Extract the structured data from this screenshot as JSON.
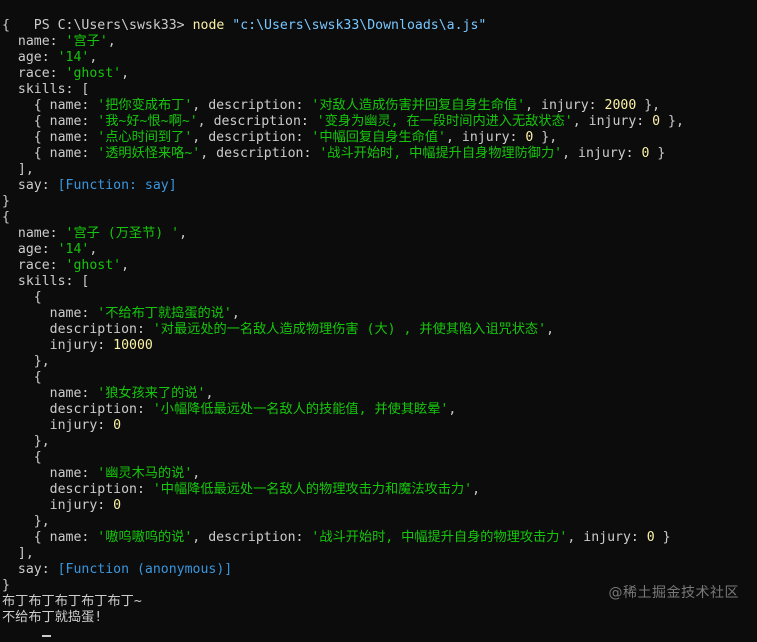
{
  "terminal": {
    "prompt": "PS C:\\Users\\swsk33> ",
    "command": "node",
    "argument": " \"c:\\Users\\swsk33\\Downloads\\a.js\""
  },
  "lines": [
    [
      [
        "p",
        "{"
      ]
    ],
    [
      [
        "k",
        "  name: "
      ],
      [
        "s",
        "'宫子'"
      ],
      [
        "p",
        ","
      ]
    ],
    [
      [
        "k",
        "  age: "
      ],
      [
        "s",
        "'14'"
      ],
      [
        "p",
        ","
      ]
    ],
    [
      [
        "k",
        "  race: "
      ],
      [
        "s",
        "'ghost'"
      ],
      [
        "p",
        ","
      ]
    ],
    [
      [
        "k",
        "  skills: ["
      ]
    ],
    [
      [
        "p",
        "    { "
      ],
      [
        "k",
        "name: "
      ],
      [
        "s",
        "'把你变成布丁'"
      ],
      [
        "p",
        ", "
      ],
      [
        "k",
        "description: "
      ],
      [
        "s",
        "'对敌人造成伤害并回复自身生命值'"
      ],
      [
        "p",
        ", "
      ],
      [
        "k",
        "injury: "
      ],
      [
        "n",
        "2000"
      ],
      [
        "p",
        " },"
      ]
    ],
    [
      [
        "p",
        "    { "
      ],
      [
        "k",
        "name: "
      ],
      [
        "s",
        "'我~好~恨~啊~'"
      ],
      [
        "p",
        ", "
      ],
      [
        "k",
        "description: "
      ],
      [
        "s",
        "'变身为幽灵, 在一段时间内进入无敌状态'"
      ],
      [
        "p",
        ", "
      ],
      [
        "k",
        "injury: "
      ],
      [
        "n",
        "0"
      ],
      [
        "p",
        " },"
      ]
    ],
    [
      [
        "p",
        "    { "
      ],
      [
        "k",
        "name: "
      ],
      [
        "s",
        "'点心时间到了'"
      ],
      [
        "p",
        ", "
      ],
      [
        "k",
        "description: "
      ],
      [
        "s",
        "'中幅回复自身生命值'"
      ],
      [
        "p",
        ", "
      ],
      [
        "k",
        "injury: "
      ],
      [
        "n",
        "0"
      ],
      [
        "p",
        " },"
      ]
    ],
    [
      [
        "p",
        "    { "
      ],
      [
        "k",
        "name: "
      ],
      [
        "s",
        "'透明妖怪来咯~'"
      ],
      [
        "p",
        ", "
      ],
      [
        "k",
        "description: "
      ],
      [
        "s",
        "'战斗开始时, 中幅提升自身物理防御力'"
      ],
      [
        "p",
        ", "
      ],
      [
        "k",
        "injury: "
      ],
      [
        "n",
        "0"
      ],
      [
        "p",
        " }"
      ]
    ],
    [
      [
        "p",
        "  ],"
      ]
    ],
    [
      [
        "k",
        "  say: "
      ],
      [
        "f",
        "[Function: say]"
      ]
    ],
    [
      [
        "p",
        "}"
      ]
    ],
    [
      [
        "p",
        "{"
      ]
    ],
    [
      [
        "k",
        "  name: "
      ],
      [
        "s",
        "'宫子 (万圣节) '"
      ],
      [
        "p",
        ","
      ]
    ],
    [
      [
        "k",
        "  age: "
      ],
      [
        "s",
        "'14'"
      ],
      [
        "p",
        ","
      ]
    ],
    [
      [
        "k",
        "  race: "
      ],
      [
        "s",
        "'ghost'"
      ],
      [
        "p",
        ","
      ]
    ],
    [
      [
        "k",
        "  skills: ["
      ]
    ],
    [
      [
        "p",
        "    {"
      ]
    ],
    [
      [
        "k",
        "      name: "
      ],
      [
        "s",
        "'不给布丁就捣蛋的说'"
      ],
      [
        "p",
        ","
      ]
    ],
    [
      [
        "k",
        "      description: "
      ],
      [
        "s",
        "'对最远处的一名敌人造成物理伤害 (大) , 并使其陷入诅咒状态'"
      ],
      [
        "p",
        ","
      ]
    ],
    [
      [
        "k",
        "      injury: "
      ],
      [
        "n",
        "10000"
      ]
    ],
    [
      [
        "p",
        "    },"
      ]
    ],
    [
      [
        "p",
        "    {"
      ]
    ],
    [
      [
        "k",
        "      name: "
      ],
      [
        "s",
        "'狼女孩来了的说'"
      ],
      [
        "p",
        ","
      ]
    ],
    [
      [
        "k",
        "      description: "
      ],
      [
        "s",
        "'小幅降低最远处一名敌人的技能值, 并使其眩晕'"
      ],
      [
        "p",
        ","
      ]
    ],
    [
      [
        "k",
        "      injury: "
      ],
      [
        "n",
        "0"
      ]
    ],
    [
      [
        "p",
        "    },"
      ]
    ],
    [
      [
        "p",
        "    {"
      ]
    ],
    [
      [
        "k",
        "      name: "
      ],
      [
        "s",
        "'幽灵木马的说'"
      ],
      [
        "p",
        ","
      ]
    ],
    [
      [
        "k",
        "      description: "
      ],
      [
        "s",
        "'中幅降低最远处一名敌人的物理攻击力和魔法攻击力'"
      ],
      [
        "p",
        ","
      ]
    ],
    [
      [
        "k",
        "      injury: "
      ],
      [
        "n",
        "0"
      ]
    ],
    [
      [
        "p",
        "    },"
      ]
    ],
    [
      [
        "p",
        "    { "
      ],
      [
        "k",
        "name: "
      ],
      [
        "s",
        "'嗷呜嗷呜的说'"
      ],
      [
        "p",
        ", "
      ],
      [
        "k",
        "description: "
      ],
      [
        "s",
        "'战斗开始时, 中幅提升自身的物理攻击力'"
      ],
      [
        "p",
        ", "
      ],
      [
        "k",
        "injury: "
      ],
      [
        "n",
        "0"
      ],
      [
        "p",
        " }"
      ]
    ],
    [
      [
        "p",
        "  ],"
      ]
    ],
    [
      [
        "k",
        "  say: "
      ],
      [
        "f",
        "[Function (anonymous)]"
      ]
    ],
    [
      [
        "p",
        "}"
      ]
    ],
    [
      [
        "out",
        "布丁布丁布丁布丁布丁~"
      ]
    ],
    [
      [
        "out",
        "不给布丁就捣蛋!"
      ]
    ]
  ],
  "watermark": "@稀土掘金技术社区"
}
